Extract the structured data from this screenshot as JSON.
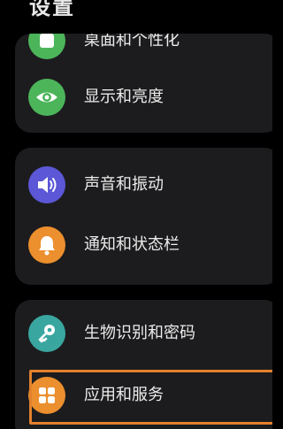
{
  "page": {
    "title": "设置"
  },
  "sections": [
    {
      "items": [
        {
          "label": "桌面和个性化",
          "icon": "palette-icon",
          "color": "#4cb55a"
        },
        {
          "label": "显示和亮度",
          "icon": "eye-icon",
          "color": "#4cb55a"
        }
      ]
    },
    {
      "items": [
        {
          "label": "声音和振动",
          "icon": "speaker-icon",
          "color": "#5b57d6"
        },
        {
          "label": "通知和状态栏",
          "icon": "bell-icon",
          "color": "#ec8f2e"
        }
      ]
    },
    {
      "items": [
        {
          "label": "生物识别和密码",
          "icon": "key-icon",
          "color": "#3aa6a0"
        },
        {
          "label": "应用和服务",
          "icon": "apps-icon",
          "color": "#ec8f2e"
        }
      ]
    }
  ],
  "highlight": {
    "target": "应用和服务",
    "color": "#e2812c"
  }
}
